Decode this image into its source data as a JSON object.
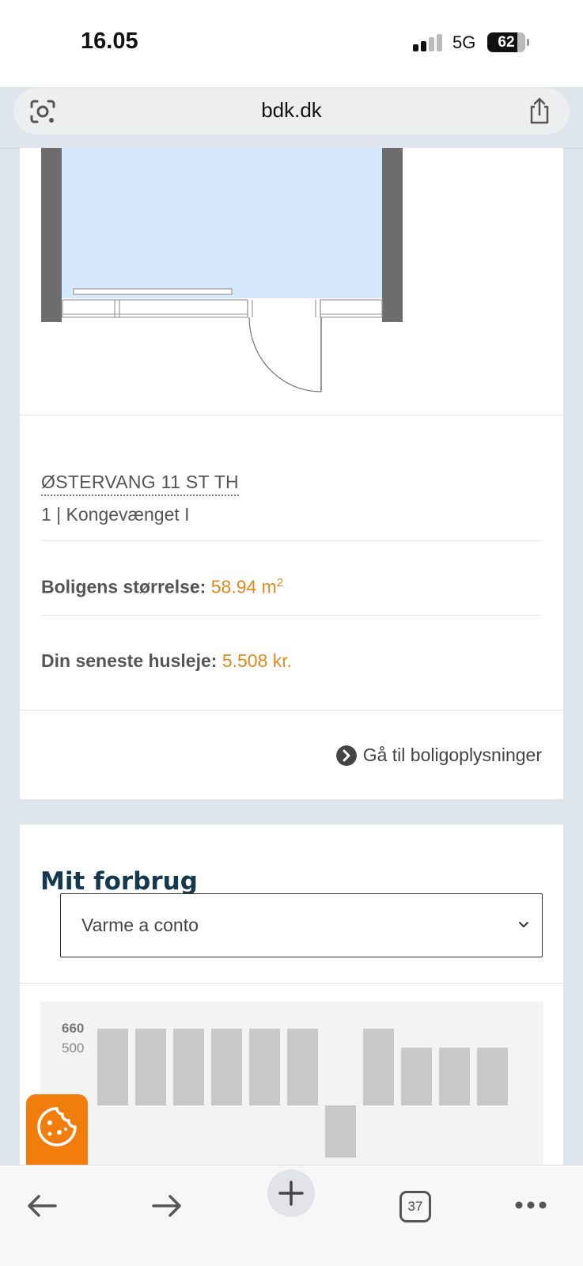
{
  "status_bar": {
    "time": "16.05",
    "network": "5G",
    "battery": "62"
  },
  "browser": {
    "url": "bdk.dk",
    "tab_count": "37"
  },
  "residence": {
    "address": "ØSTERVANG 11 ST TH",
    "department": "1 | Kongevænget I",
    "size_label": "Boligens størrelse:",
    "size_value": "58.94 m",
    "size_unit_sup": "2",
    "rent_label": "Din seneste husleje:",
    "rent_value": "5.508 kr.",
    "link_label": "Gå til boligoplysninger"
  },
  "consumption": {
    "title": "Mit forbrug",
    "selected_option": "Varme a conto"
  },
  "chart_data": {
    "type": "bar",
    "y_ticks": [
      "660",
      "500"
    ],
    "values": [
      660,
      660,
      660,
      660,
      660,
      660,
      -450,
      660,
      500,
      500,
      500
    ],
    "ylim": [
      -900,
      660
    ]
  },
  "colors": {
    "accent": "#e08a1e",
    "title": "#14384e",
    "cookie": "#f07d0c",
    "bar": "#c8c8c8"
  },
  "icons": {
    "lens": "google-lens-icon",
    "share": "share-icon",
    "link": "chevron-circle-right-icon",
    "select": "chevron-down-icon",
    "cookie": "cookie-icon",
    "back": "arrow-left-icon",
    "forward": "arrow-right-icon",
    "new_tab": "plus-icon",
    "tabs": "tabs-icon",
    "more": "more-dots-icon"
  }
}
